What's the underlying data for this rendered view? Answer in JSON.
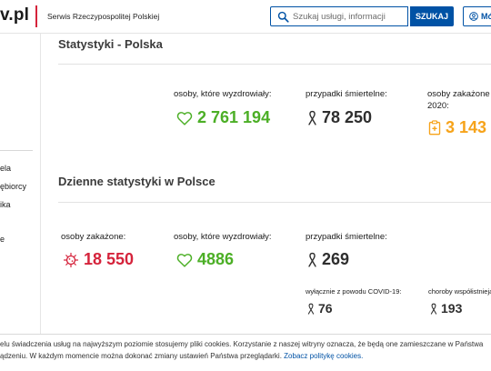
{
  "header": {
    "logo_text": "v.pl",
    "service_name": "Serwis Rzeczypospolitej Polskiej",
    "search_placeholder": "Szukaj usługi, informacji",
    "search_button": "SZUKAJ",
    "account_button": "Mó"
  },
  "sidebar": {
    "items": [
      {
        "label": "ela"
      },
      {
        "label": "ębiorcy"
      },
      {
        "label": "ika"
      },
      {
        "label": "e"
      }
    ]
  },
  "stats_total": {
    "title": "Statystyki - Polska",
    "recovered_label": "osoby, które wyzdrowiały:",
    "recovered_value": "2 761 194",
    "deaths_label": "przypadki śmiertelne:",
    "deaths_value": "78 250",
    "infected_label_line1": "osoby zakażone (",
    "infected_label_line2": "2020:",
    "infected_value": "3 143"
  },
  "stats_daily": {
    "title": "Dzienne statystyki w Polsce",
    "infected_label": "osoby zakażone:",
    "infected_value": "18 550",
    "recovered_label": "osoby, które wyzdrowiały:",
    "recovered_value": "4886",
    "deaths_label": "przypadki śmiertelne:",
    "deaths_value": "269",
    "covid_only_label": "wyłącznie z powodu COVID-19:",
    "covid_only_value": "76",
    "comorbid_label": "choroby współistniejąc",
    "comorbid_value": "193"
  },
  "cookie": {
    "line1": "elu świadczenia usług na najwyższym poziomie stosujemy pliki cookies. Korzystanie z naszej witryny oznacza, że będą one zamieszczane w Państwa",
    "line2": "ądzeniu. W każdym momencie można dokonać zmiany ustawień Państwa przeglądarki. ",
    "link": "Zobacz politykę cookies."
  },
  "colors": {
    "brand_blue": "#0052a5",
    "brand_red": "#d5233b",
    "recovered_green": "#4caf26",
    "infected_orange": "#f6a31a"
  }
}
